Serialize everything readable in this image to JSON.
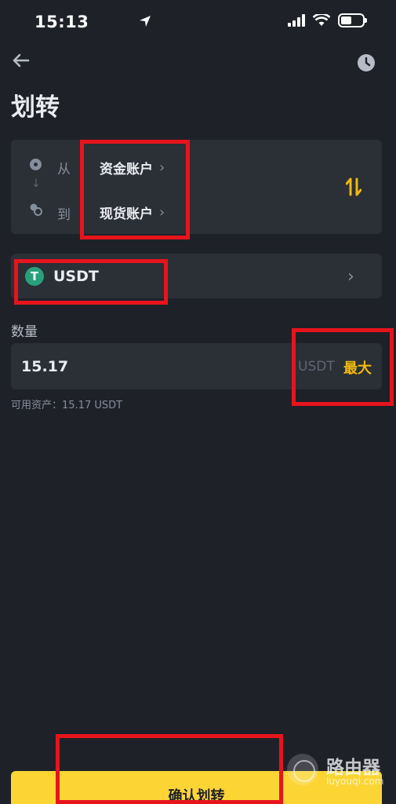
{
  "status_bar": {
    "time": "15:13"
  },
  "page": {
    "title": "划转"
  },
  "transfer": {
    "from_label": "从",
    "from_account": "资金账户",
    "to_label": "到",
    "to_account": "现货账户"
  },
  "coin": {
    "symbol": "USDT",
    "icon_letter": "T"
  },
  "quantity": {
    "label": "数量",
    "value": "15.17",
    "unit": "USDT",
    "max_label": "最大",
    "available_text": "可用资产：15.17 USDT"
  },
  "confirm_button": {
    "label": "确认划转"
  },
  "watermark": {
    "name": "路由器",
    "url": "luyouqi.com"
  },
  "colors": {
    "background": "#1f2129",
    "card": "#2b2f36",
    "accent": "#f0b90b",
    "button": "#fcd535",
    "highlight_box": "#e8141c"
  }
}
